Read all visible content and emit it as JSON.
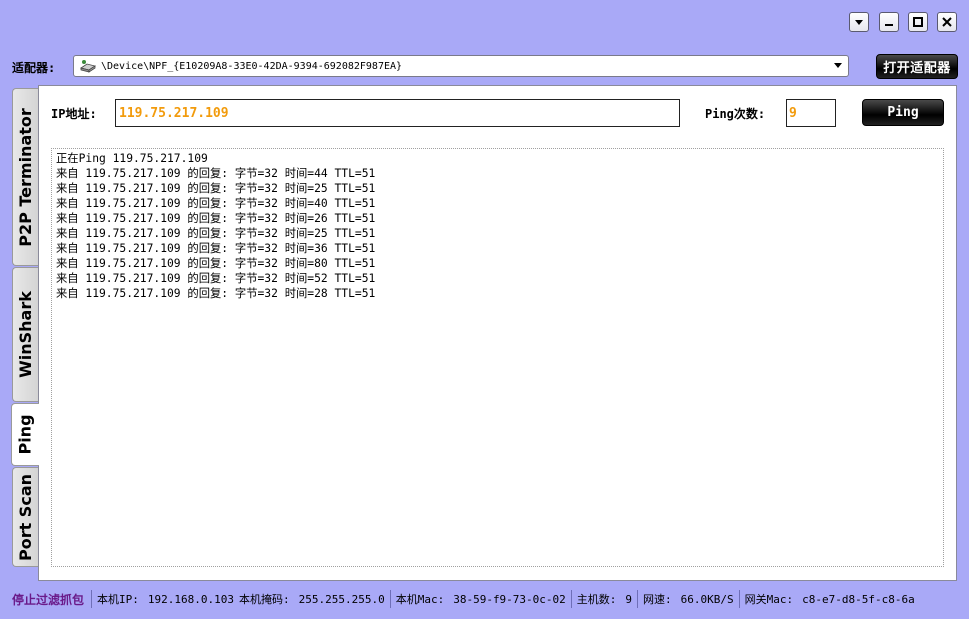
{
  "window": {
    "controls": [
      "menu-icon",
      "minimize-icon",
      "maximize-icon",
      "close-icon"
    ]
  },
  "adapter": {
    "label": "适配器:",
    "value": "\\Device\\NPF_{E10209A8-33E0-42DA-9394-692082F987EA}",
    "open_button": "打开适配器"
  },
  "tabs": [
    {
      "label": "P2P Terminator",
      "active": false
    },
    {
      "label": "WinShark",
      "active": false
    },
    {
      "label": "Ping",
      "active": true
    },
    {
      "label": "Port Scan",
      "active": false
    }
  ],
  "ping": {
    "ip_label": "IP地址:",
    "ip_value": "119.75.217.109",
    "count_label": "Ping次数:",
    "count_value": "9",
    "button": "Ping"
  },
  "output_lines": [
    "正在Ping 119.75.217.109",
    "来自 119.75.217.109 的回复: 字节=32 时间=44 TTL=51",
    "来自 119.75.217.109 的回复: 字节=32 时间=25 TTL=51",
    "来自 119.75.217.109 的回复: 字节=32 时间=40 TTL=51",
    "来自 119.75.217.109 的回复: 字节=32 时间=26 TTL=51",
    "来自 119.75.217.109 的回复: 字节=32 时间=25 TTL=51",
    "来自 119.75.217.109 的回复: 字节=32 时间=36 TTL=51",
    "来自 119.75.217.109 的回复: 字节=32 时间=80 TTL=51",
    "来自 119.75.217.109 的回复: 字节=32 时间=52 TTL=51",
    "来自 119.75.217.109 的回复: 字节=32 时间=28 TTL=51"
  ],
  "status": {
    "stop_capture": "停止过滤抓包",
    "local_ip_label": "本机IP:",
    "local_ip": "192.168.0.103",
    "mask_label": "本机掩码:",
    "mask": "255.255.255.0",
    "mac_label": "本机Mac:",
    "mac": "38-59-f9-73-0c-02",
    "hosts_label": "主机数:",
    "hosts": "9",
    "speed_label": "网速:",
    "speed": "66.0KB/S",
    "gateway_mac_label": "网关Mac:",
    "gateway_mac": "c8-e7-d8-5f-c8-6a"
  },
  "colors": {
    "background": "#a9a9f7",
    "input_text": "#f29b0c",
    "stop_text": "#6a1a8a"
  }
}
